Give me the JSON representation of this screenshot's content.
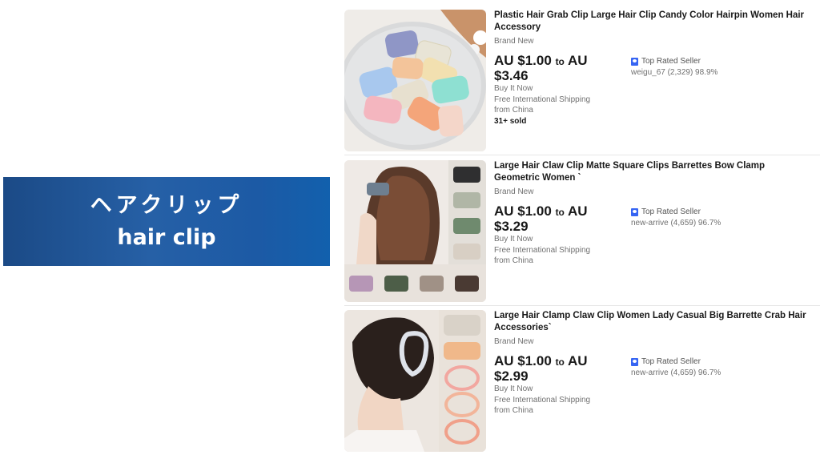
{
  "banner": {
    "jp": "ヘアクリップ",
    "en": "hair clip"
  },
  "listings": [
    {
      "title": "Plastic Hair Grab Clip Large Hair Clip Candy Color Hairpin Women Hair Accessory",
      "condition": "Brand New",
      "price_low": "AU $1.00",
      "to": "to",
      "price_high_a": "AU",
      "price_high_b": "$3.46",
      "buy": "Buy It Now",
      "ship1": "Free International Shipping",
      "ship2": "from China",
      "sold": "31+ sold",
      "badge": "Top Rated Seller",
      "seller": "weigu_67 (2,329) 98.9%"
    },
    {
      "title": "Large Hair Claw Clip Matte Square Clips Barrettes Bow Clamp Geometric Women `",
      "condition": "Brand New",
      "price_low": "AU $1.00",
      "to": "to",
      "price_high_a": "AU",
      "price_high_b": "$3.29",
      "buy": "Buy It Now",
      "ship1": "Free International Shipping",
      "ship2": "from China",
      "badge": "Top Rated Seller",
      "seller": "new-arrive (4,659) 96.7%"
    },
    {
      "title": "Large Hair Clamp Claw Clip Women Lady Casual Big Barrette Crab Hair Accessories`",
      "condition": "Brand New",
      "price_low": "AU $1.00",
      "to": "to",
      "price_high_a": "AU",
      "price_high_b": "$2.99",
      "buy": "Buy It Now",
      "ship1": "Free International Shipping",
      "ship2": "from China",
      "badge": "Top Rated Seller",
      "seller": "new-arrive (4,659) 96.7%"
    }
  ],
  "colors": {
    "banner": "#1c5aa5",
    "badge": "#3665f3"
  },
  "icons": {
    "badge": "top-rated-seller-icon"
  }
}
